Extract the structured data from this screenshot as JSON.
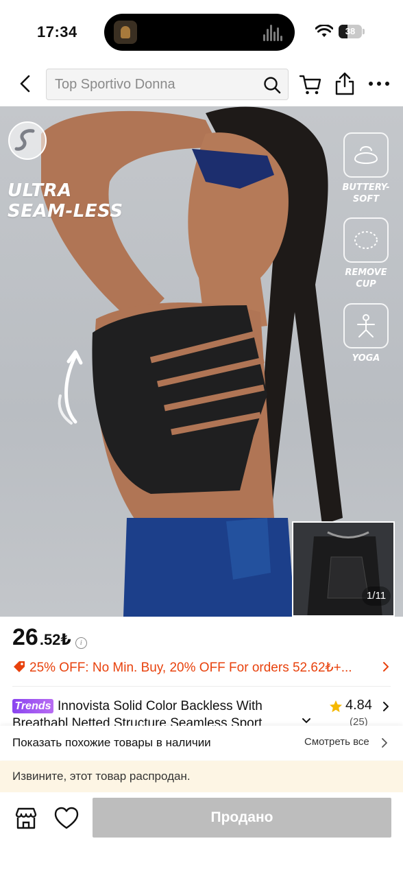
{
  "status_bar": {
    "time": "17:34",
    "battery_level": "38"
  },
  "search": {
    "placeholder": "Top Sportivo Donna"
  },
  "gallery": {
    "headline_line1": "ULTRA",
    "headline_line2": "SEAM-LESS",
    "features": [
      {
        "label": "BUTTERY-SOFT",
        "icon": "buttery-soft-icon"
      },
      {
        "label": "REMOVE CUP",
        "icon": "remove-cup-icon"
      },
      {
        "label": "YOGA",
        "icon": "yoga-icon"
      }
    ],
    "counter": "1/11"
  },
  "price": {
    "integer": "26",
    "decimal": ".52₺"
  },
  "promo": {
    "text": "25% OFF: No Min. Buy,  20% OFF For orders 52.62₺+..."
  },
  "product": {
    "badge": "Trends",
    "title_line1": "Innovista Solid Color Backless With",
    "title_line2": "Breathabl Netted Structure Seamless Sport",
    "rating": "4.84",
    "review_count": "(25)"
  },
  "similar": {
    "text": "Показать похожие товары в наличии",
    "link_label": "Смотреть все"
  },
  "notice": {
    "text": "Извините, этот товар распродан."
  },
  "actions": {
    "sold_label": "Продано"
  },
  "colors": {
    "promo_orange": "#e8420d",
    "trends_purple": "#8a45f0",
    "disabled_gray": "#bdbdbd",
    "notice_bg": "#fdf5e4",
    "star_yellow": "#f5b800"
  }
}
